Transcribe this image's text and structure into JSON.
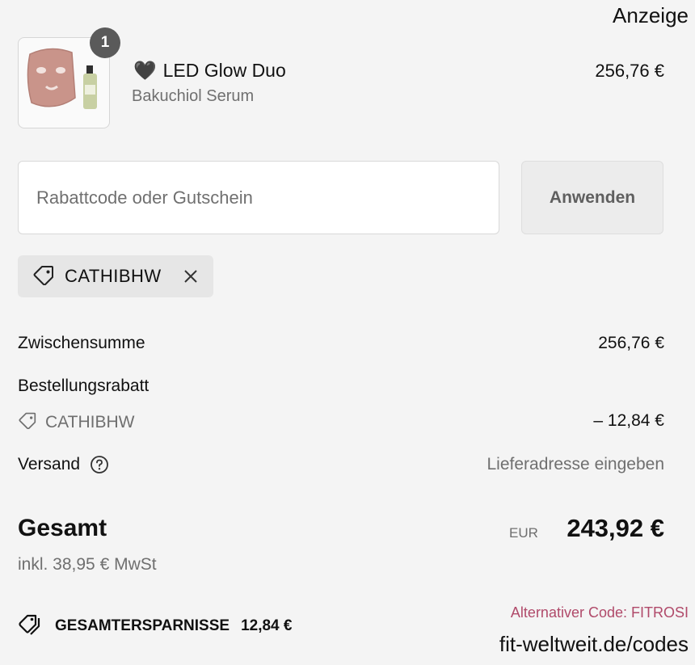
{
  "watermark": {
    "ad_label": "Anzeige"
  },
  "cart": {
    "item": {
      "quantity": "1",
      "emoji": "🖤",
      "name": "LED Glow Duo",
      "variant": "Bakuchiol Serum",
      "price": "256,76 €"
    }
  },
  "discount": {
    "placeholder": "Rabattcode oder Gutschein",
    "value": "",
    "apply_label": "Anwenden",
    "applied_code": "CATHIBHW"
  },
  "summary": {
    "subtotal_label": "Zwischensumme",
    "subtotal_value": "256,76 €",
    "order_discount_label": "Bestellungsrabatt",
    "order_discount_code": "CATHIBHW",
    "order_discount_value": "– 12,84 €",
    "shipping_label": "Versand",
    "shipping_value": "Lieferadresse eingeben",
    "total_label": "Gesamt",
    "currency": "EUR",
    "total_value": "243,92 €",
    "tax_note": "inkl. 38,95 € MwSt",
    "savings_label": "GESAMTERSPARNISSE",
    "savings_value": "12,84 €"
  },
  "overlay": {
    "alt_code": "Alternativer Code: FITROSI",
    "site": "fit-weltweit.de/codes"
  },
  "colors": {
    "background": "#f4f4f4",
    "badge": "#5a5a5a",
    "overlay_accent": "#b04a6a"
  },
  "icons": [
    "tag-icon",
    "close-icon",
    "help-icon",
    "tags-icon"
  ]
}
